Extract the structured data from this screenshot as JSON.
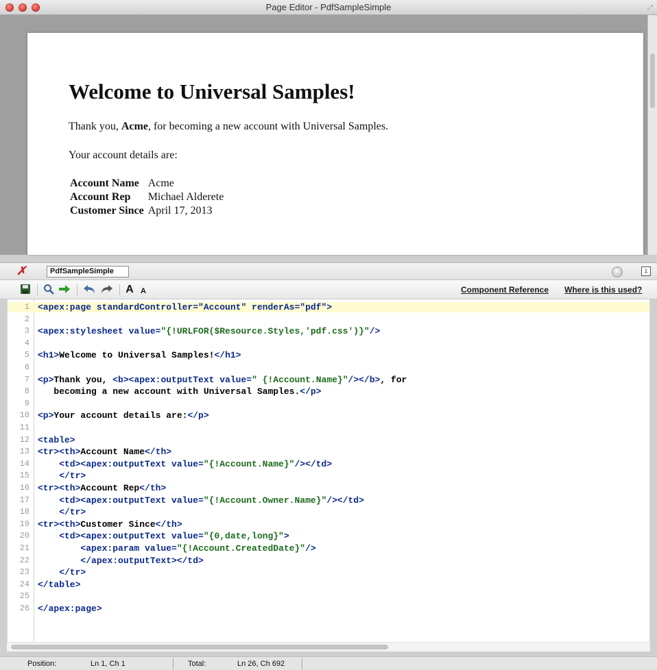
{
  "window": {
    "title": "Page Editor - PdfSampleSimple"
  },
  "preview": {
    "heading": "Welcome to Universal Samples!",
    "thanks_before": "Thank you, ",
    "thanks_name": "Acme",
    "thanks_after": ", for becoming a new account with Universal Samples.",
    "details_intro": "Your account details are:",
    "rows": [
      {
        "label": "Account Name",
        "value": "Acme"
      },
      {
        "label": "Account Rep",
        "value": "Michael Alderete"
      },
      {
        "label": "Customer Since",
        "value": "April 17, 2013"
      }
    ]
  },
  "editor": {
    "file_tab": "PdfSampleSimple",
    "links": {
      "component_reference": "Component Reference",
      "where_used": "Where is this used?"
    },
    "toolbar": {
      "font_larger": "A",
      "font_smaller": "A"
    },
    "code_lines": [
      {
        "n": "1",
        "segs": [
          {
            "t": "<apex:page standardController=\"Account\" renderAs=\"pdf\">",
            "c": "tag"
          }
        ]
      },
      {
        "n": "2",
        "segs": []
      },
      {
        "n": "3",
        "segs": [
          {
            "t": "<apex:stylesheet value=",
            "c": "tag"
          },
          {
            "t": "\"{!URLFOR($Resource.Styles,'pdf.css')}\"",
            "c": "str"
          },
          {
            "t": "/>",
            "c": "tag"
          }
        ]
      },
      {
        "n": "4",
        "segs": []
      },
      {
        "n": "5",
        "segs": [
          {
            "t": "<h1>",
            "c": "tag"
          },
          {
            "t": "Welcome to Universal Samples!",
            "c": ""
          },
          {
            "t": "</h1>",
            "c": "tag"
          }
        ]
      },
      {
        "n": "6",
        "segs": []
      },
      {
        "n": "7",
        "segs": [
          {
            "t": "<p>",
            "c": "tag"
          },
          {
            "t": "Thank you, ",
            "c": ""
          },
          {
            "t": "<b><apex:outputText value=",
            "c": "tag"
          },
          {
            "t": "\" {!Account.Name}\"",
            "c": "str"
          },
          {
            "t": "/></b>",
            "c": "tag"
          },
          {
            "t": ", for",
            "c": ""
          }
        ]
      },
      {
        "n": "8",
        "segs": [
          {
            "t": "   becoming a new account with Universal Samples.",
            "c": ""
          },
          {
            "t": "</p>",
            "c": "tag"
          }
        ]
      },
      {
        "n": "9",
        "segs": []
      },
      {
        "n": "10",
        "segs": [
          {
            "t": "<p>",
            "c": "tag"
          },
          {
            "t": "Your account details are:",
            "c": ""
          },
          {
            "t": "</p>",
            "c": "tag"
          }
        ]
      },
      {
        "n": "11",
        "segs": []
      },
      {
        "n": "12",
        "segs": [
          {
            "t": "<table>",
            "c": "tag"
          }
        ]
      },
      {
        "n": "13",
        "segs": [
          {
            "t": "<tr><th>",
            "c": "tag"
          },
          {
            "t": "Account Name",
            "c": ""
          },
          {
            "t": "</th>",
            "c": "tag"
          }
        ]
      },
      {
        "n": "14",
        "segs": [
          {
            "t": "    <td><apex:outputText value=",
            "c": "tag"
          },
          {
            "t": "\"{!Account.Name}\"",
            "c": "str"
          },
          {
            "t": "/></td>",
            "c": "tag"
          }
        ]
      },
      {
        "n": "15",
        "segs": [
          {
            "t": "    </tr>",
            "c": "tag"
          }
        ]
      },
      {
        "n": "16",
        "segs": [
          {
            "t": "<tr><th>",
            "c": "tag"
          },
          {
            "t": "Account Rep",
            "c": ""
          },
          {
            "t": "</th>",
            "c": "tag"
          }
        ]
      },
      {
        "n": "17",
        "segs": [
          {
            "t": "    <td><apex:outputText value=",
            "c": "tag"
          },
          {
            "t": "\"{!Account.Owner.Name}\"",
            "c": "str"
          },
          {
            "t": "/></td>",
            "c": "tag"
          }
        ]
      },
      {
        "n": "18",
        "segs": [
          {
            "t": "    </tr>",
            "c": "tag"
          }
        ]
      },
      {
        "n": "19",
        "segs": [
          {
            "t": "<tr><th>",
            "c": "tag"
          },
          {
            "t": "Customer Since",
            "c": ""
          },
          {
            "t": "</th>",
            "c": "tag"
          }
        ]
      },
      {
        "n": "20",
        "segs": [
          {
            "t": "    <td><apex:outputText value=",
            "c": "tag"
          },
          {
            "t": "\"{0,date,long}\"",
            "c": "str"
          },
          {
            "t": ">",
            "c": "tag"
          }
        ]
      },
      {
        "n": "21",
        "segs": [
          {
            "t": "        <apex:param value=",
            "c": "tag"
          },
          {
            "t": "\"{!Account.CreatedDate}\"",
            "c": "str"
          },
          {
            "t": "/>",
            "c": "tag"
          }
        ]
      },
      {
        "n": "22",
        "segs": [
          {
            "t": "        </apex:outputText></td>",
            "c": "tag"
          }
        ]
      },
      {
        "n": "23",
        "segs": [
          {
            "t": "    </tr>",
            "c": "tag"
          }
        ]
      },
      {
        "n": "24",
        "segs": [
          {
            "t": "</table>",
            "c": "tag"
          }
        ]
      },
      {
        "n": "25",
        "segs": []
      },
      {
        "n": "26",
        "segs": [
          {
            "t": "</apex:page>",
            "c": "tag"
          }
        ]
      }
    ]
  },
  "status": {
    "position_label": "Position:",
    "position_value": "Ln 1, Ch 1",
    "total_label": "Total:",
    "total_value": "Ln 26, Ch 692"
  },
  "colors": {
    "tag": "#0b2a8a",
    "string": "#1e6b1e",
    "current_line": "#fffbd1"
  }
}
